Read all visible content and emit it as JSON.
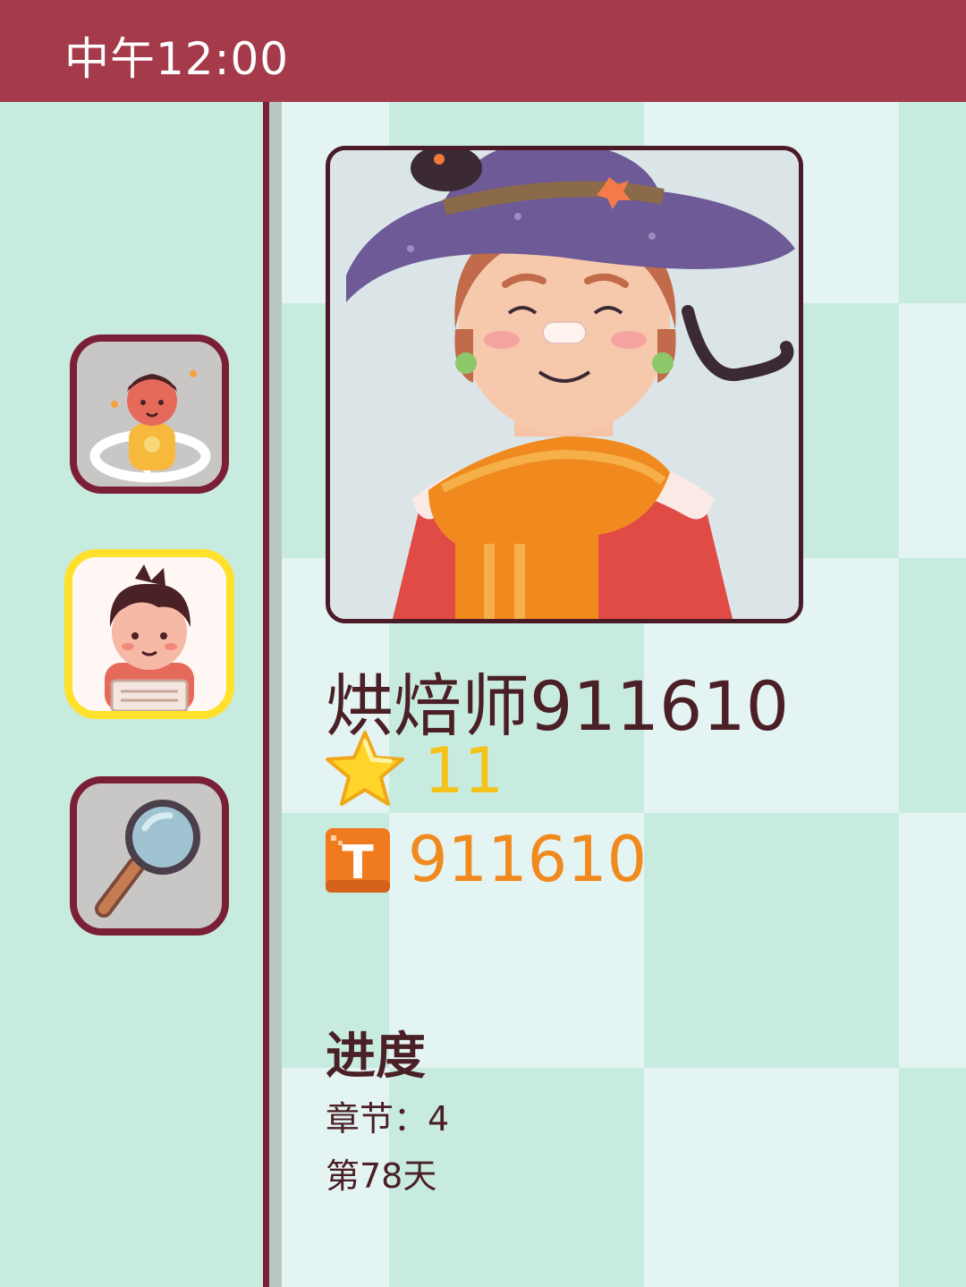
{
  "status_bar": {
    "time": "中午12:00"
  },
  "sidebar": {
    "items": [
      {
        "name": "rotate-character-icon",
        "active": false
      },
      {
        "name": "profile-icon",
        "active": true
      },
      {
        "name": "search-icon",
        "active": false
      }
    ]
  },
  "profile": {
    "name": "烘焙师911610",
    "stars": "11",
    "player_id": "911610",
    "badge_letter": "T"
  },
  "progress": {
    "title": "进度",
    "chapter": "章节：4",
    "day": "第78天"
  },
  "colors": {
    "status_bar": "#a43a4a",
    "divider": "#7a1f36",
    "active_border": "#ffe02a",
    "stars_text": "#f3c21b",
    "id_text": "#f18a1e"
  }
}
